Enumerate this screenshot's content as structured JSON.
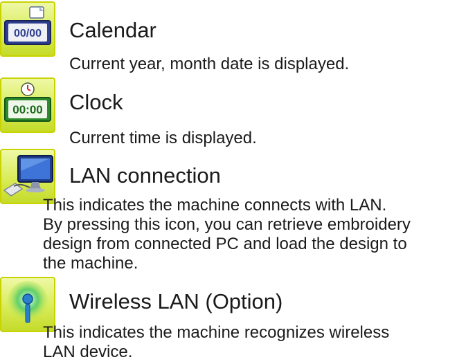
{
  "sections": [
    {
      "icon": "calendar-icon",
      "icon_text": "00/00",
      "title": "Calendar",
      "description": "Current year, month date is displayed."
    },
    {
      "icon": "clock-icon",
      "icon_text": "00:00",
      "title": "Clock",
      "description": "Current  time is displayed."
    },
    {
      "icon": "lan-connection-icon",
      "title": "LAN connection",
      "description_lines": [
        "This indicates the machine connects with LAN.",
        "By pressing this icon, you can retrieve embroidery",
        "design from connected PC and load the design to",
        "the machine."
      ]
    },
    {
      "icon": "wireless-lan-icon",
      "title": "Wireless LAN (Option)",
      "description_lines": [
        "This indicates the machine recognizes wireless",
        "LAN device."
      ]
    }
  ],
  "colors": {
    "icon_background": "#d9ec58",
    "icon_border": "#c9d300",
    "text": "#1a1a1a"
  }
}
